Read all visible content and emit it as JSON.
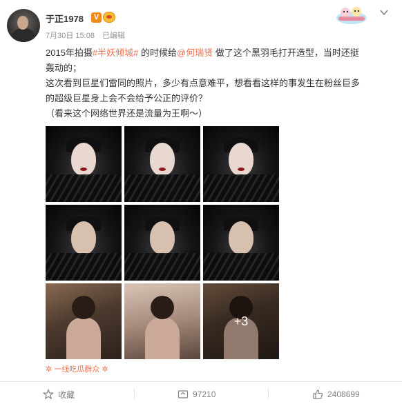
{
  "post": {
    "username": "于正1978",
    "verified_badge": "V",
    "vip_badge": "vip-icon",
    "date": "7月30日 15:08",
    "edited": "已编辑",
    "text_part1": "2015年拍摄",
    "topic_tag": "#半妖倾城#",
    "text_part2": " 的时候给",
    "mention": "@何瑞贤",
    "text_part3": " 做了这个黑羽毛打开造型，当时还挺",
    "text_line2": "轰动的；",
    "text_line3": "这次看到巨星们雷同的照片，多少有点意难平，想看看这样的事发生在粉丝巨多",
    "text_line4": "的超级巨星身上会不会给予公正的评价？",
    "text_line5": "（看来这个网络世界还是流量为王啊～）",
    "more_photos": "+3",
    "source": "一线吃瓜群众"
  },
  "actions": {
    "favorite": "收藏",
    "repost_count": "97210",
    "like_count": "2408699"
  },
  "colors": {
    "link": "#eb7350",
    "text": "#333333",
    "meta": "#939393",
    "verified": "#f28b1b"
  }
}
